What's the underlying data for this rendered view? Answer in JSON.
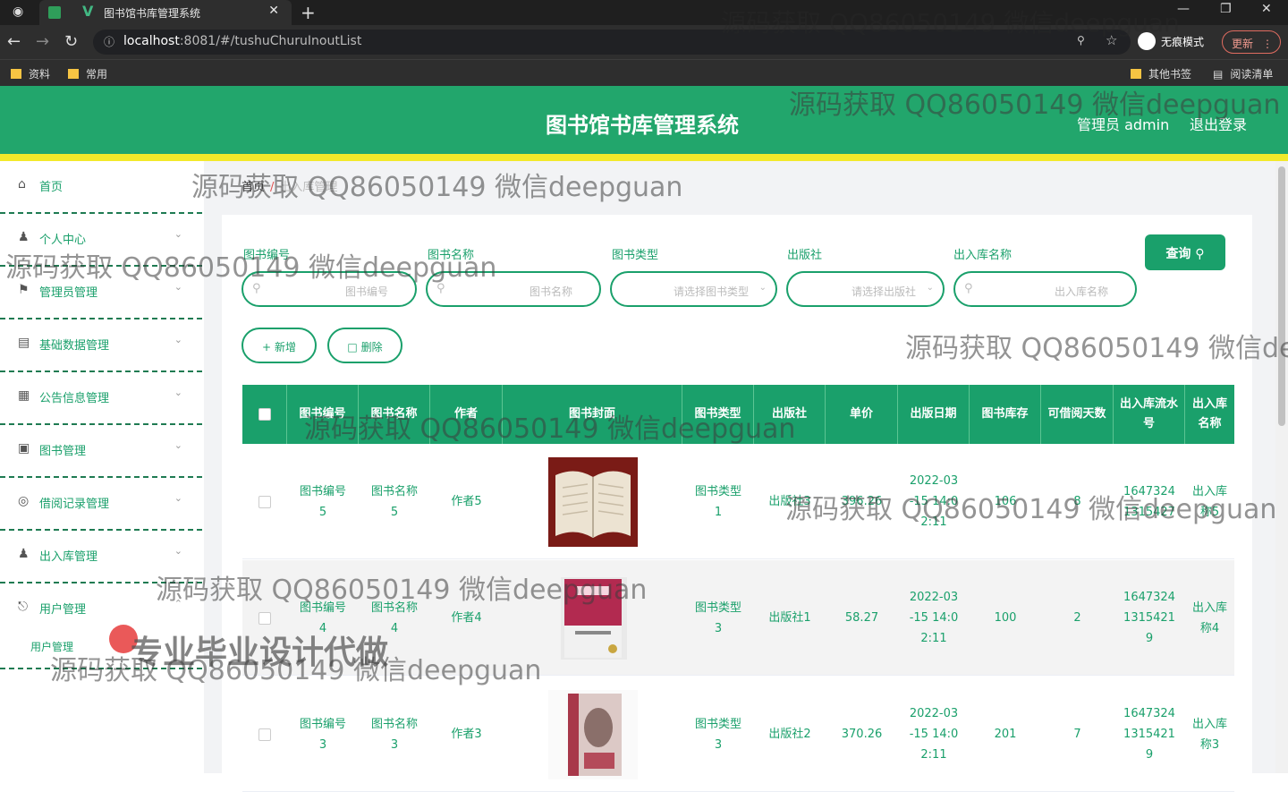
{
  "browser": {
    "tab_title": "图书馆书库管理系统",
    "url_host": "localhost",
    "url_rest": ":8081/#/tushuChuruInoutList",
    "incognito": "无痕模式",
    "update": "更新",
    "bookmarks": [
      "资料",
      "常用"
    ],
    "bookmarks_right": [
      "其他书签",
      "阅读清单"
    ]
  },
  "header": {
    "title": "图书馆书库管理系统",
    "admin": "管理员 admin",
    "logout": "退出登录"
  },
  "sidebar": {
    "items": [
      {
        "label": "首页",
        "icon": "home-icon"
      },
      {
        "label": "个人中心",
        "icon": "user-icon"
      },
      {
        "label": "管理员管理",
        "icon": "flag-icon"
      },
      {
        "label": "基础数据管理",
        "icon": "chart-icon"
      },
      {
        "label": "公告信息管理",
        "icon": "clipboard-icon"
      },
      {
        "label": "图书管理",
        "icon": "briefcase-icon"
      },
      {
        "label": "借阅记录管理",
        "icon": "compass-icon"
      },
      {
        "label": "出入库管理",
        "icon": "user-icon"
      },
      {
        "label": "用户管理",
        "icon": "mic-icon"
      }
    ],
    "sub_item": "用户管理"
  },
  "breadcrumb": {
    "home": "首页",
    "current": "出入库管理"
  },
  "filters": {
    "book_no": {
      "label": "图书编号",
      "placeholder": "图书编号"
    },
    "book_name": {
      "label": "图书名称",
      "placeholder": "图书名称"
    },
    "book_type": {
      "label": "图书类型",
      "placeholder": "请选择图书类型"
    },
    "publisher": {
      "label": "出版社",
      "placeholder": "请选择出版社"
    },
    "io_name": {
      "label": "出入库名称",
      "placeholder": "出入库名称"
    },
    "query": "查询"
  },
  "actions": {
    "add": "新增",
    "delete": "删除"
  },
  "table": {
    "headers": [
      "图书编号",
      "图书名称",
      "作者",
      "图书封面",
      "图书类型",
      "出版社",
      "单价",
      "出版日期",
      "图书库存",
      "可借阅天数",
      "出入库流水号",
      "出入库名称"
    ],
    "rows": [
      {
        "no": "图书编号\n5",
        "name": "图书名称\n5",
        "author": "作者5",
        "type": "图书类型\n1",
        "publisher": "出版社3",
        "price": "396.26",
        "date": "2022-03\n-15 14:0\n2:11",
        "stock": "106",
        "days": "8",
        "serial": "1647324\n1315427",
        "ioname": "出入库\n称5"
      },
      {
        "no": "图书编号\n4",
        "name": "图书名称\n4",
        "author": "作者4",
        "type": "图书类型\n3",
        "publisher": "出版社1",
        "price": "58.27",
        "date": "2022-03\n-15 14:0\n2:11",
        "stock": "100",
        "days": "2",
        "serial": "1647324\n1315421\n9",
        "ioname": "出入库\n称4"
      },
      {
        "no": "图书编号\n3",
        "name": "图书名称\n3",
        "author": "作者3",
        "type": "图书类型\n3",
        "publisher": "出版社2",
        "price": "370.26",
        "date": "2022-03\n-15 14:0\n2:11",
        "stock": "201",
        "days": "7",
        "serial": "1647324\n1315421\n9",
        "ioname": "出入库\n称3"
      }
    ]
  },
  "overlays": {
    "watermark": "源码获取 QQ86050149 微信deepguan",
    "watermark_cut": "源码获取 QQ86050149 微信de",
    "watermark_top": "源码获取 QQ86050149 微信deepguan",
    "promo": "专业毕业设计代做"
  },
  "colors": {
    "primary": "#1aa06b",
    "header": "#22a66c",
    "accent_bar": "#f3e92a"
  }
}
